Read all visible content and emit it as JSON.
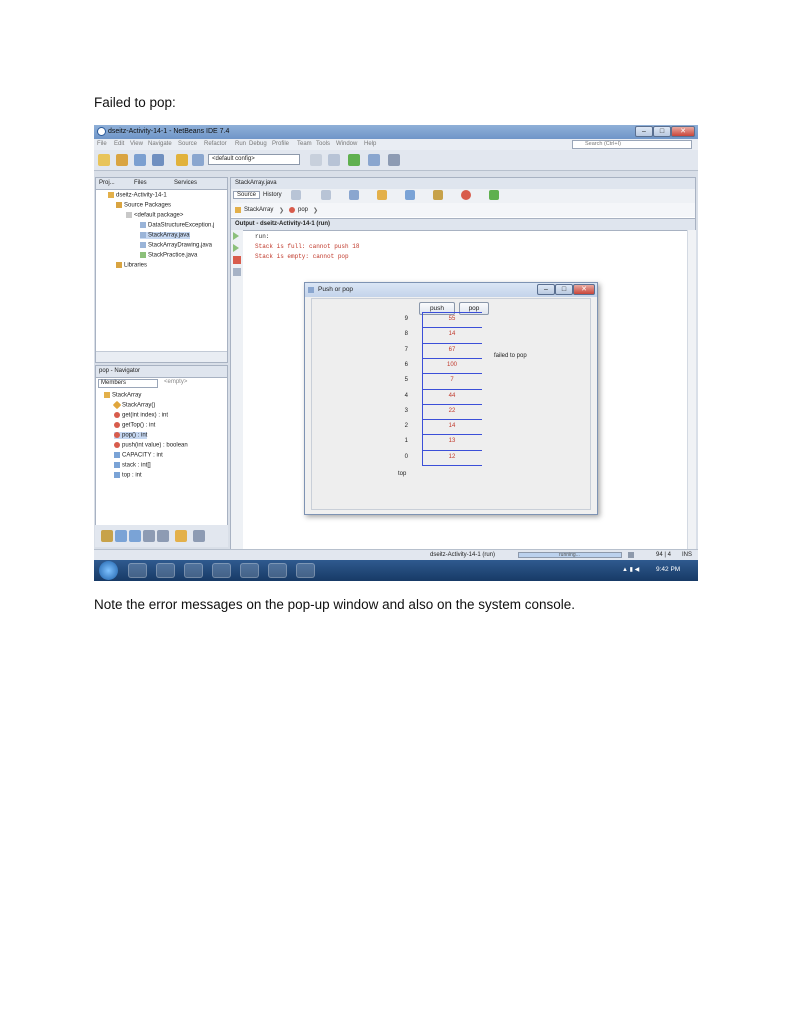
{
  "document": {
    "heading": "Failed to pop:",
    "note": "Note the error messages on the pop-up window and also on the system console."
  },
  "window": {
    "title": "dseitz-Activity-14-1 - NetBeans IDE 7.4",
    "menu": [
      "File",
      "Edit",
      "View",
      "Navigate",
      "Source",
      "Refactor",
      "Run",
      "Debug",
      "Profile",
      "Team",
      "Tools",
      "Window",
      "Help"
    ],
    "search_placeholder": "Search (Ctrl+I)",
    "config": "<default config>"
  },
  "projects": {
    "tabs": [
      "Proj...",
      "Files",
      "Services"
    ],
    "tree": [
      "dseitz-Activity-14-1",
      "Source Packages",
      "<default package>",
      "DataStructureException.j",
      "StackArray.java",
      "StackArrayDrawing.java",
      "StackPractice.java",
      "Libraries"
    ]
  },
  "navigator": {
    "title": "pop - Navigator",
    "filter": "Members",
    "empty": "<empty>",
    "items": [
      "StackArray",
      "StackArray()",
      "get(int index) : int",
      "getTop() : int",
      "pop() : int",
      "push(int value) : boolean",
      "CAPACITY : int",
      "stack : int[]",
      "top : int"
    ]
  },
  "editor": {
    "tab": "StackArray.java",
    "source_tab": "Source",
    "history_tab": "History",
    "breadcrumb": [
      "StackArray",
      "pop"
    ],
    "output_tab": "Output - dseitz-Activity-14-1 (run)",
    "console": [
      "run:",
      "Stack is full: cannot push 18",
      "Stack is empty: cannot pop"
    ]
  },
  "dialog": {
    "title": "Push or pop",
    "push_label": "push",
    "pop_label": "pop",
    "message": "failed to pop",
    "top_label": "top",
    "stack": {
      "indices": [
        "9",
        "8",
        "7",
        "6",
        "5",
        "4",
        "3",
        "2",
        "1",
        "0"
      ],
      "values": [
        "55",
        "14",
        "67",
        "100",
        "7",
        "44",
        "22",
        "14",
        "13",
        "12"
      ]
    }
  },
  "status": {
    "run": "dseitz-Activity-14-1 (run)",
    "progress": "running...",
    "position": "94 | 4",
    "mode": "INS"
  },
  "taskbar": {
    "time": "9:42 PM"
  },
  "colors": {
    "value_text": "#c0392b",
    "stack_lines": "#3b4fd8",
    "console_error": "#c0392b"
  }
}
